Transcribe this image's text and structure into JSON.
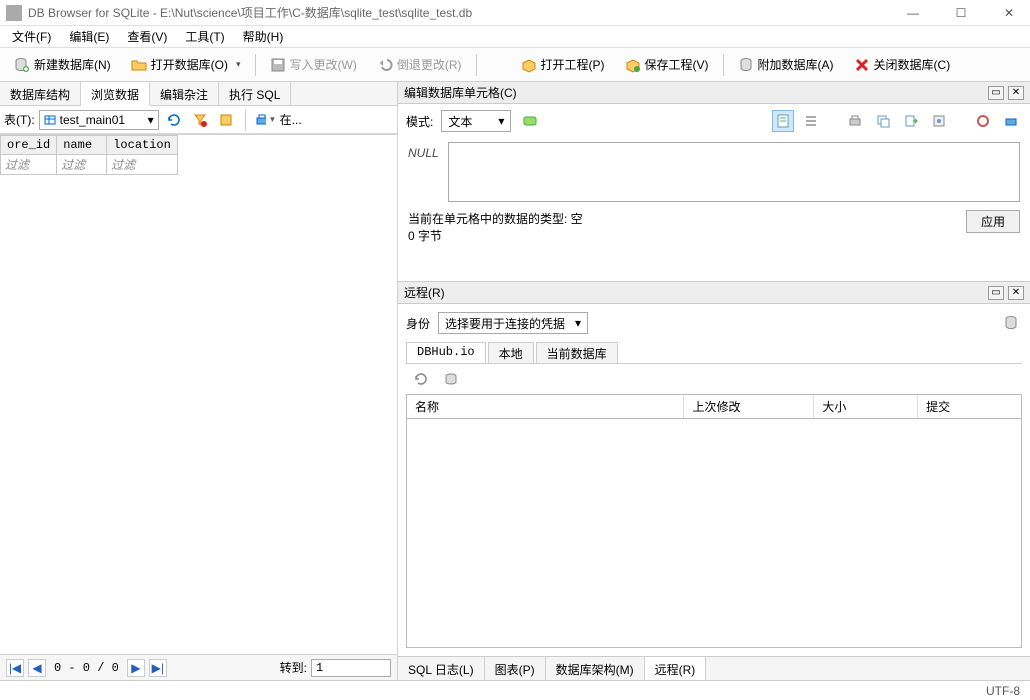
{
  "window": {
    "title": "DB Browser for SQLite - E:\\Nut\\science\\项目工作\\C-数据库\\sqlite_test\\sqlite_test.db"
  },
  "menu": {
    "file": "文件(F)",
    "edit": "编辑(E)",
    "view": "查看(V)",
    "tools": "工具(T)",
    "help": "帮助(H)"
  },
  "toolbar": {
    "new_db": "新建数据库(N)",
    "open_db": "打开数据库(O)",
    "write_changes": "写入更改(W)",
    "revert_changes": "倒退更改(R)",
    "open_project": "打开工程(P)",
    "save_project": "保存工程(V)",
    "attach_db": "附加数据库(A)",
    "close_db": "关闭数据库(C)"
  },
  "left_tabs": {
    "structure": "数据库结构",
    "browse": "浏览数据",
    "pragmas": "编辑杂注",
    "sql": "执行 SQL"
  },
  "browse": {
    "table_label": "表(T):",
    "selected_table": "test_main01",
    "quick_find": "在...",
    "columns": [
      "ore_id",
      "name",
      "location"
    ],
    "filter_placeholder": "过滤",
    "nav_record_range": "0 - 0 / 0",
    "goto_label": "转到:",
    "goto_value": "1"
  },
  "cell_editor": {
    "title": "编辑数据库单元格(C)",
    "mode_label": "模式:",
    "mode_value": "文本",
    "null_marker": "NULL",
    "type_info_line1": "当前在单元格中的数据的类型: 空",
    "type_info_line2": "0 字节",
    "apply": "应用"
  },
  "remote": {
    "title": "远程(R)",
    "identity_label": "身份",
    "identity_value": "选择要用于连接的凭据",
    "tabs": {
      "dbhub": "DBHub.io",
      "local": "本地",
      "current": "当前数据库"
    },
    "cols": {
      "name": "名称",
      "last_modified": "上次修改",
      "size": "大小",
      "commit": "提交"
    }
  },
  "bottom_tabs": {
    "sql_log": "SQL 日志(L)",
    "plot": "图表(P)",
    "schema": "数据库架构(M)",
    "remote": "远程(R)"
  },
  "status": {
    "encoding": "UTF-8"
  },
  "icons": {
    "db": "🗄",
    "folder": "📂",
    "disk": "💾",
    "undo": "↶",
    "box": "📦",
    "attach": "🗃",
    "close_x": "✖"
  }
}
